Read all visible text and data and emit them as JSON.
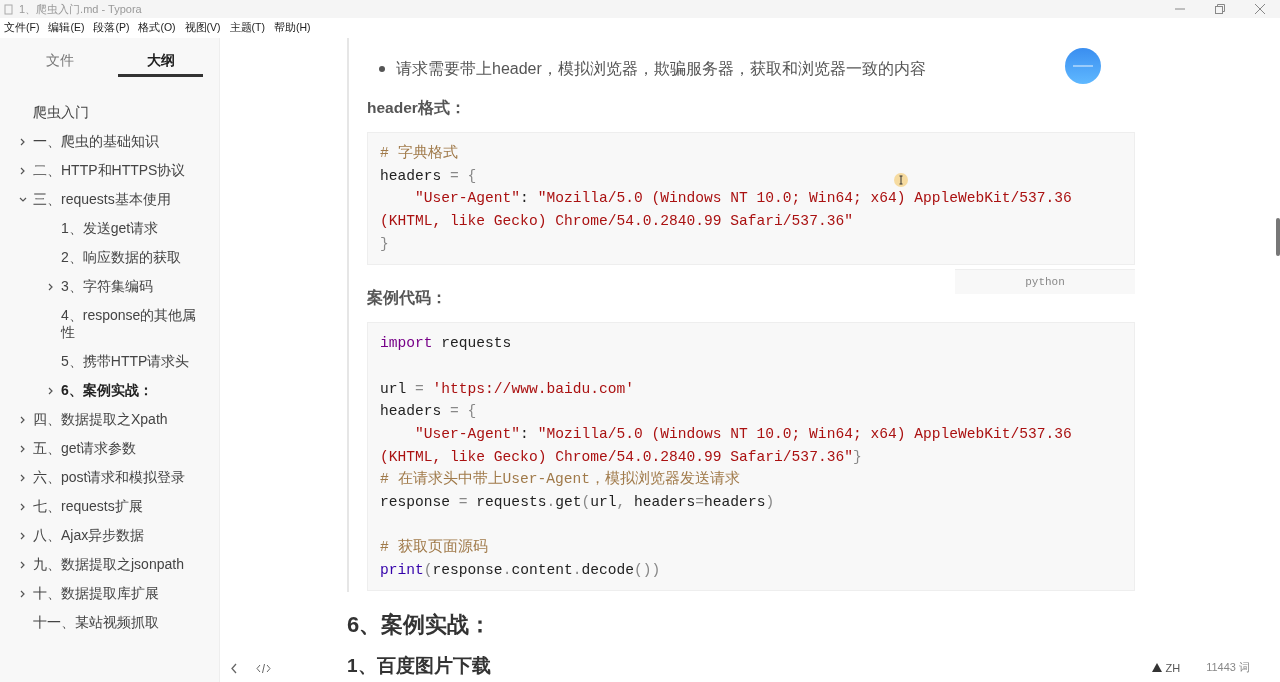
{
  "window": {
    "title": "1、爬虫入门.md - Typora"
  },
  "menu": [
    "文件(F)",
    "编辑(E)",
    "段落(P)",
    "格式(O)",
    "视图(V)",
    "主题(T)",
    "帮助(H)"
  ],
  "sidebar": {
    "tabs": [
      {
        "label": "文件",
        "selected": false
      },
      {
        "label": "大纲",
        "selected": true
      }
    ],
    "outline": [
      {
        "label": "爬虫入门",
        "selected": false
      },
      {
        "label": "一、爬虫的基础知识",
        "expanded": false,
        "selected": false
      },
      {
        "label": "二、HTTP和HTTPS协议",
        "expanded": false,
        "selected": false
      },
      {
        "label": "三、requests基本使用",
        "expanded": true,
        "selected": false,
        "children": [
          {
            "label": "1、发送get请求",
            "selected": false
          },
          {
            "label": "2、响应数据的获取",
            "selected": false
          },
          {
            "label": "3、字符集编码",
            "expanded": false,
            "selected": false
          },
          {
            "label": "4、response的其他属性",
            "selected": false
          },
          {
            "label": "5、携带HTTP请求头",
            "selected": false
          },
          {
            "label": "6、案例实战：",
            "expanded": false,
            "selected": true
          }
        ]
      },
      {
        "label": "四、数据提取之Xpath",
        "expanded": false,
        "selected": false
      },
      {
        "label": "五、get请求参数",
        "expanded": false,
        "selected": false
      },
      {
        "label": "六、post请求和模拟登录",
        "expanded": false,
        "selected": false
      },
      {
        "label": "七、requests扩展",
        "expanded": false,
        "selected": false
      },
      {
        "label": "八、Ajax异步数据",
        "expanded": false,
        "selected": false
      },
      {
        "label": "九、数据提取之jsonpath",
        "expanded": false,
        "selected": false
      },
      {
        "label": "十、数据提取库扩展",
        "expanded": false,
        "selected": false
      },
      {
        "label": "十一、某站视频抓取",
        "selected": false
      }
    ]
  },
  "editor": {
    "section": [
      {
        "kind": "bullets",
        "items": [
          "请求需要带上header，模拟浏览器，欺骗服务器，获取和浏览器一致的内容"
        ]
      },
      {
        "kind": "label",
        "text": "header格式："
      },
      {
        "kind": "code",
        "language": "python",
        "lines": [
          {
            "kind": "code",
            "tokens": [
              {
                "kind": "comment",
                "text": "# 字典格式"
              }
            ]
          },
          {
            "kind": "code",
            "tokens": [
              {
                "kind": "plain",
                "text": "headers"
              },
              {
                "kind": "op",
                "text": " = {"
              }
            ]
          },
          {
            "kind": "code",
            "indent": true,
            "tokens": [
              {
                "kind": "string",
                "text": "\"User-Agent\""
              },
              {
                "kind": "plain",
                "text": ": "
              },
              {
                "kind": "string",
                "text": "\"Mozilla/5.0 (Windows NT 10.0; Win64; x64) AppleWebKit/537.36 (KHTML, like Gecko) Chrome/54.0.2840.99 Safari/537.36\""
              }
            ]
          },
          {
            "kind": "code",
            "tokens": [
              {
                "kind": "op",
                "text": "}"
              }
            ]
          }
        ]
      },
      {
        "kind": "label",
        "text": "案例代码："
      },
      {
        "kind": "code",
        "lines": [
          {
            "kind": "code",
            "tokens": [
              {
                "kind": "keyword",
                "text": "import"
              },
              {
                "kind": "plain",
                "text": " requests"
              }
            ]
          },
          {
            "kind": "blank"
          },
          {
            "kind": "code",
            "tokens": [
              {
                "kind": "plain",
                "text": "url"
              },
              {
                "kind": "op",
                "text": " = "
              },
              {
                "kind": "string",
                "text": "'https://www.baidu.com'"
              }
            ]
          },
          {
            "kind": "code",
            "tokens": [
              {
                "kind": "plain",
                "text": "headers"
              },
              {
                "kind": "op",
                "text": " = {"
              }
            ]
          },
          {
            "kind": "code",
            "indent": true,
            "tokens": [
              {
                "kind": "string",
                "text": "\"User-Agent\""
              },
              {
                "kind": "plain",
                "text": ": "
              },
              {
                "kind": "string",
                "text": "\"Mozilla/5.0 (Windows NT 10.0; Win64; x64) AppleWebKit/537.36 (KHTML, like Gecko) Chrome/54.0.2840.99 Safari/537.36\""
              },
              {
                "kind": "op",
                "text": "}"
              }
            ]
          },
          {
            "kind": "code",
            "tokens": [
              {
                "kind": "comment",
                "text": "# 在请求头中带上User-Agent，模拟浏览器发送请求"
              }
            ]
          },
          {
            "kind": "code",
            "tokens": [
              {
                "kind": "plain",
                "text": "response"
              },
              {
                "kind": "op",
                "text": " = "
              },
              {
                "kind": "plain",
                "text": "requests"
              },
              {
                "kind": "op",
                "text": "."
              },
              {
                "kind": "plain",
                "text": "get"
              },
              {
                "kind": "op",
                "text": "("
              },
              {
                "kind": "plain",
                "text": "url"
              },
              {
                "kind": "op",
                "text": ", "
              },
              {
                "kind": "plain",
                "text": "headers"
              },
              {
                "kind": "op",
                "text": "="
              },
              {
                "kind": "plain",
                "text": "headers"
              },
              {
                "kind": "op",
                "text": ")"
              }
            ]
          },
          {
            "kind": "blank"
          },
          {
            "kind": "code",
            "tokens": [
              {
                "kind": "comment",
                "text": "# 获取页面源码"
              }
            ]
          },
          {
            "kind": "code",
            "tokens": [
              {
                "kind": "builtin",
                "text": "print"
              },
              {
                "kind": "op",
                "text": "("
              },
              {
                "kind": "plain",
                "text": "response"
              },
              {
                "kind": "op",
                "text": "."
              },
              {
                "kind": "plain",
                "text": "content"
              },
              {
                "kind": "op",
                "text": "."
              },
              {
                "kind": "plain",
                "text": "decode"
              },
              {
                "kind": "op",
                "text": "())"
              }
            ]
          }
        ]
      }
    ],
    "headings": [
      {
        "kind": "h2",
        "text": "6、案例实战："
      },
      {
        "kind": "h3",
        "text": "1、百度图片下载"
      }
    ]
  },
  "status_bar": {
    "language": "ZH",
    "word_count": "11443 词"
  }
}
